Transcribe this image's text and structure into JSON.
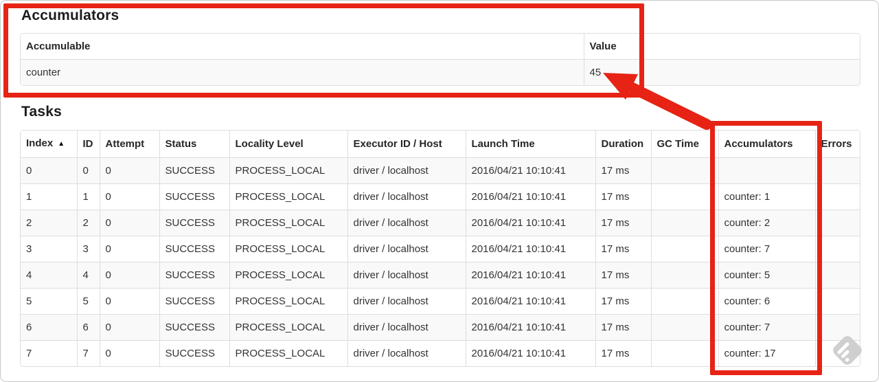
{
  "accumulators": {
    "title": "Accumulators",
    "table": {
      "headers": [
        "Accumulable",
        "Value"
      ],
      "rows": [
        [
          "counter",
          "45"
        ]
      ]
    }
  },
  "tasks": {
    "title": "Tasks",
    "table": {
      "headers": [
        "Index",
        "ID",
        "Attempt",
        "Status",
        "Locality Level",
        "Executor ID / Host",
        "Launch Time",
        "Duration",
        "GC Time",
        "Accumulators",
        "Errors"
      ],
      "sort_icon": "▲",
      "rows": [
        [
          "0",
          "0",
          "0",
          "SUCCESS",
          "PROCESS_LOCAL",
          "driver / localhost",
          "2016/04/21 10:10:41",
          "17 ms",
          "",
          "",
          ""
        ],
        [
          "1",
          "1",
          "0",
          "SUCCESS",
          "PROCESS_LOCAL",
          "driver / localhost",
          "2016/04/21 10:10:41",
          "17 ms",
          "",
          "counter: 1",
          ""
        ],
        [
          "2",
          "2",
          "0",
          "SUCCESS",
          "PROCESS_LOCAL",
          "driver / localhost",
          "2016/04/21 10:10:41",
          "17 ms",
          "",
          "counter: 2",
          ""
        ],
        [
          "3",
          "3",
          "0",
          "SUCCESS",
          "PROCESS_LOCAL",
          "driver / localhost",
          "2016/04/21 10:10:41",
          "17 ms",
          "",
          "counter: 7",
          ""
        ],
        [
          "4",
          "4",
          "0",
          "SUCCESS",
          "PROCESS_LOCAL",
          "driver / localhost",
          "2016/04/21 10:10:41",
          "17 ms",
          "",
          "counter: 5",
          ""
        ],
        [
          "5",
          "5",
          "0",
          "SUCCESS",
          "PROCESS_LOCAL",
          "driver / localhost",
          "2016/04/21 10:10:41",
          "17 ms",
          "",
          "counter: 6",
          ""
        ],
        [
          "6",
          "6",
          "0",
          "SUCCESS",
          "PROCESS_LOCAL",
          "driver / localhost",
          "2016/04/21 10:10:41",
          "17 ms",
          "",
          "counter: 7",
          ""
        ],
        [
          "7",
          "7",
          "0",
          "SUCCESS",
          "PROCESS_LOCAL",
          "driver / localhost",
          "2016/04/21 10:10:41",
          "17 ms",
          "",
          "counter: 17",
          ""
        ]
      ]
    }
  },
  "annotations": {
    "highlight_color": "#e62314",
    "items": [
      "box-around-accumulators-section",
      "box-around-accumulators-column",
      "arrow-pointing-to-value-45"
    ]
  },
  "colors": {
    "table_border": "#dddddd",
    "striped_row": "#f9f9f9",
    "text": "#333333"
  }
}
